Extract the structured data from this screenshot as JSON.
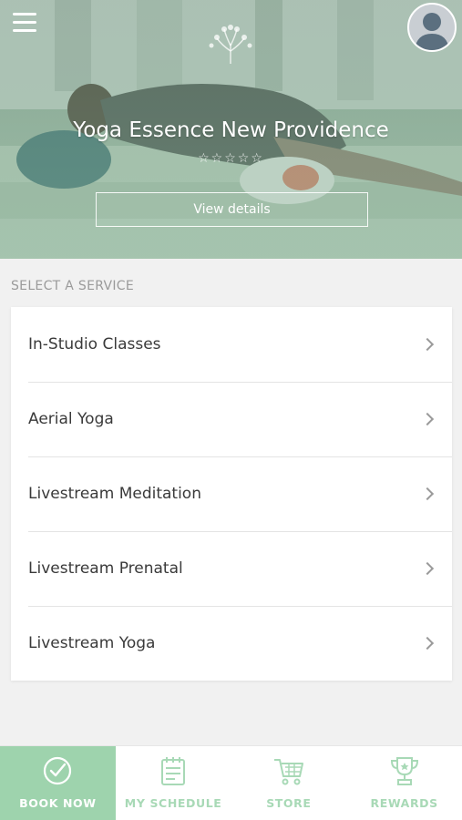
{
  "header": {
    "studio_name": "Yoga Essence New Providence",
    "rating_stars": "☆☆☆☆☆",
    "view_details_label": "View details",
    "logo_text": "Yoga Essence"
  },
  "services": {
    "section_title": "SELECT A SERVICE",
    "items": [
      {
        "label": "In-Studio Classes"
      },
      {
        "label": "Aerial Yoga"
      },
      {
        "label": "Livestream Meditation"
      },
      {
        "label": "Livestream Prenatal"
      },
      {
        "label": "Livestream Yoga"
      }
    ]
  },
  "tabbar": {
    "tabs": [
      {
        "label": "BOOK NOW",
        "icon": "check-circle-icon",
        "active": true
      },
      {
        "label": "MY SCHEDULE",
        "icon": "calendar-icon",
        "active": false
      },
      {
        "label": "STORE",
        "icon": "cart-icon",
        "active": false
      },
      {
        "label": "REWARDS",
        "icon": "trophy-icon",
        "active": false
      }
    ]
  },
  "colors": {
    "accent": "#9ed3ad",
    "accent_text": "#a8d9b6",
    "background": "#f1f1f1"
  }
}
